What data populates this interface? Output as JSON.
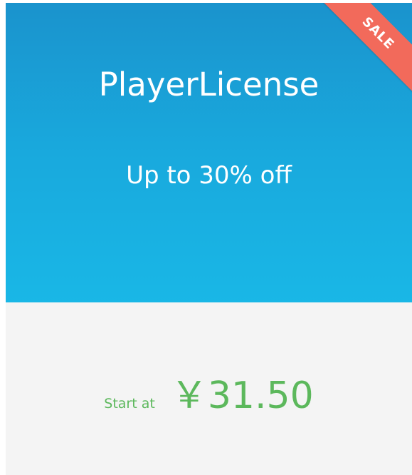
{
  "card": {
    "product_name": "PlayerLicense",
    "discount_text": "Up to 30% off",
    "ribbon_label": "SALE",
    "price_prefix": "Start at",
    "price_amount": "￥31.50"
  },
  "colors": {
    "hero_gradient_top": "#1a93cd",
    "hero_gradient_bottom": "#19b7e6",
    "ribbon": "#f26a5b",
    "price_panel": "#f4f4f4",
    "price_text": "#5cb85c"
  }
}
